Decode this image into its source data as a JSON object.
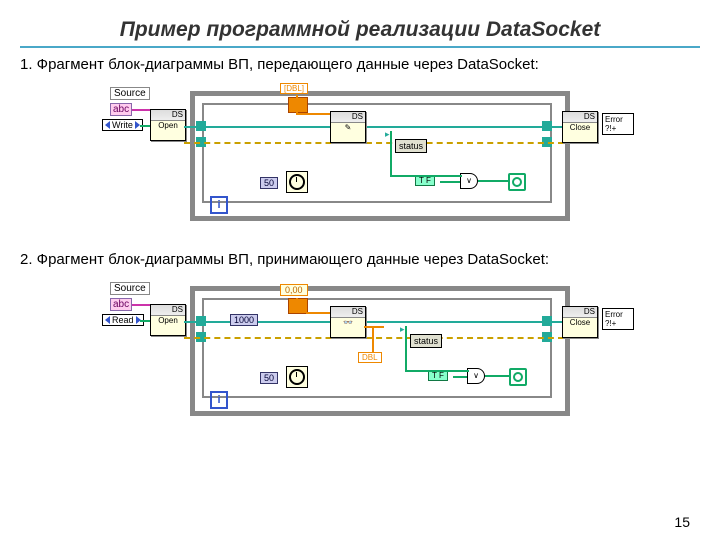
{
  "title": "Пример программной реализации DataSocket",
  "sub1": "1. Фрагмент блок-диаграммы ВП, передающего данные через DataSocket:",
  "sub2": "2. Фрагмент блок-диаграммы ВП, принимающего данные через DataSocket:",
  "pagenum": "15",
  "d1": {
    "source_label": "Source",
    "source_term": "abc",
    "mode": "Write",
    "open_label": "Open",
    "close_label": "Close",
    "ds_tag": "DS",
    "dbl_array": "[DBL]",
    "timer_ms": "50",
    "status": "status",
    "tf": "T F",
    "or": "∨",
    "i": "i",
    "error": "Error\n?!+"
  },
  "d2": {
    "source_label": "Source",
    "source_term": "abc",
    "mode": "Read",
    "open_label": "Open",
    "close_label": "Close",
    "ds_tag": "DS",
    "ms_const": "1000",
    "value": "0,00",
    "timer_ms": "50",
    "dbl_out": "DBL",
    "status": "status",
    "tf": "T F",
    "or": "∨",
    "i": "i",
    "error": "Error\n?!+"
  }
}
